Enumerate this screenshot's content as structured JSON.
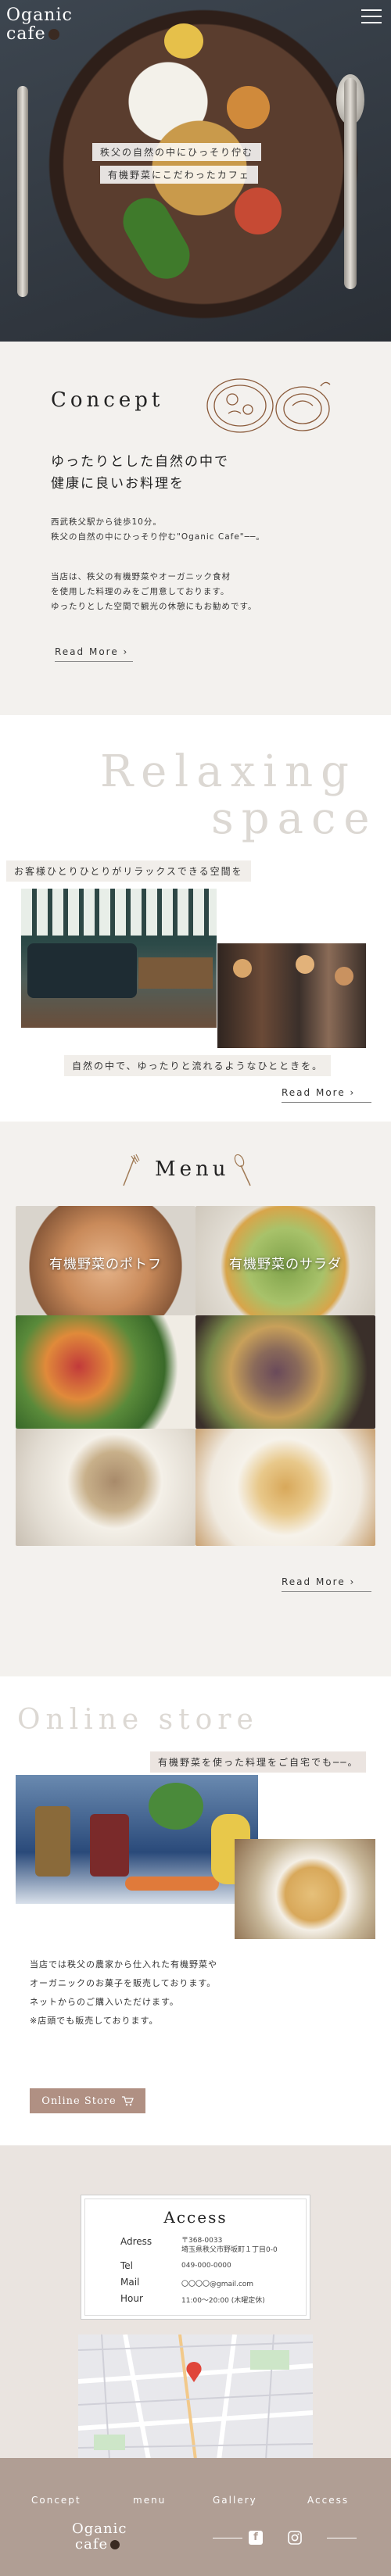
{
  "header": {
    "logo_line1": "Oganic",
    "logo_line2": "cafe",
    "hero_tag1": "秩父の自然の中にひっそり佇む",
    "hero_tag2": "有機野菜にこだわったカフェ"
  },
  "concept": {
    "title": "Concept",
    "heading_line1": "ゆったりとした自然の中で",
    "heading_line2": "健康に良いお料理を",
    "para1_line1": "西武秩父駅から徒歩10分。",
    "para1_line2": "秩父の自然の中にひっそり佇む\"Oganic Cafe\"──。",
    "para2_line1": "当店は、秩父の有機野菜やオーガニック食材",
    "para2_line2": "を使用した料理のみをご用意しております。",
    "para2_line3": "ゆったりとした空間で観光の休憩にもお勧めです。",
    "readmore": "Read More"
  },
  "relax": {
    "title_line1": "Relaxing",
    "title_line2": "space",
    "strip1": "お客様ひとりひとりがリラックスできる空間を",
    "strip2": "自然の中で、ゆったりと流れるようなひとときを。",
    "readmore": "Read More"
  },
  "menu": {
    "title": "Menu",
    "item1": "有機野菜のポトフ",
    "item2": "有機野菜のサラダ",
    "readmore": "Read More"
  },
  "online": {
    "title": "Online store",
    "strip": "有機野菜を使った料理をご自宅でも──。",
    "text_line1": "当店では秩父の農家から仕入れた有機野菜や",
    "text_line2": "オーガニックのお菓子を販売しております。",
    "text_line3": "ネットからのご購入いただけます。",
    "text_line4": "※店頭でも販売しております。",
    "button": "Online Store"
  },
  "access": {
    "title": "Access",
    "rows": [
      {
        "label": "Adress",
        "value1": "〒368-0033",
        "value2": "埼玉県秩父市野坂町１丁目0-0"
      },
      {
        "label": "Tel",
        "value1": "049-000-0000"
      },
      {
        "label": "Mail",
        "value1": "〇〇〇〇@gmail.com"
      },
      {
        "label": "Hour",
        "value1": "11:00～20:00 (木曜定休)"
      }
    ]
  },
  "footer": {
    "nav": [
      "Concept",
      "menu",
      "Gallery",
      "Access"
    ],
    "logo_line1": "Oganic",
    "logo_line2": "cafe"
  },
  "colors": {
    "accent": "#b09083",
    "footer_bg": "#b09e94",
    "section_bg": "#f3f1ee"
  }
}
